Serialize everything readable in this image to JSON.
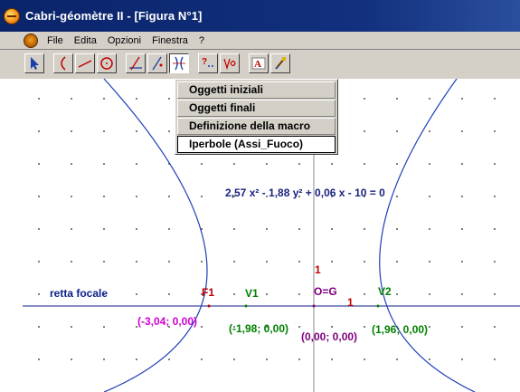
{
  "window": {
    "title": "Cabri-géomètre II - [Figura N°1]"
  },
  "menubar": {
    "items": [
      "File",
      "Edita",
      "Opzioni",
      "Finestra",
      "?"
    ]
  },
  "toolbar": {
    "tools": [
      "pointer-tool",
      "curves-tool",
      "lines-tool",
      "circle-tool",
      "construct-tool",
      "transform-tool",
      "macro-tool",
      "check-tool",
      "measure-tool",
      "display-tool",
      "draw-tool"
    ],
    "active_tool": "macro-tool"
  },
  "macro_menu": {
    "items": [
      "Oggetti iniziali",
      "Oggetti finali",
      "Definizione della macro",
      "Iperbole (Assi_Fuoco)"
    ],
    "selected_index": 3
  },
  "figure": {
    "equation": "2,57 x² - 1,88 y² + 0,06 x - 10 = 0",
    "line_label": "retta focale",
    "f1_label": "F1",
    "f1_coords": "(-3,04; 0,00)",
    "v1_label": "V1",
    "v1_coords": "(-1,98; 0,00)",
    "origin_label": "O=G",
    "origin_coords": "(0,00; 0,00)",
    "v2_label": "V2",
    "v2_coords": "(1,96; 0,00)",
    "unit_y": "1",
    "unit_x": "1"
  },
  "colors": {
    "title_bar": "#0a246a",
    "hyperbola": "#1f3fb8",
    "equation": "#1a237e",
    "focal_line_label": "#0d1f8a",
    "f1": "#c00000",
    "f1_coords": "#d000d0",
    "vertex": "#008000",
    "origin": "#800080",
    "unit": "#c00000"
  }
}
